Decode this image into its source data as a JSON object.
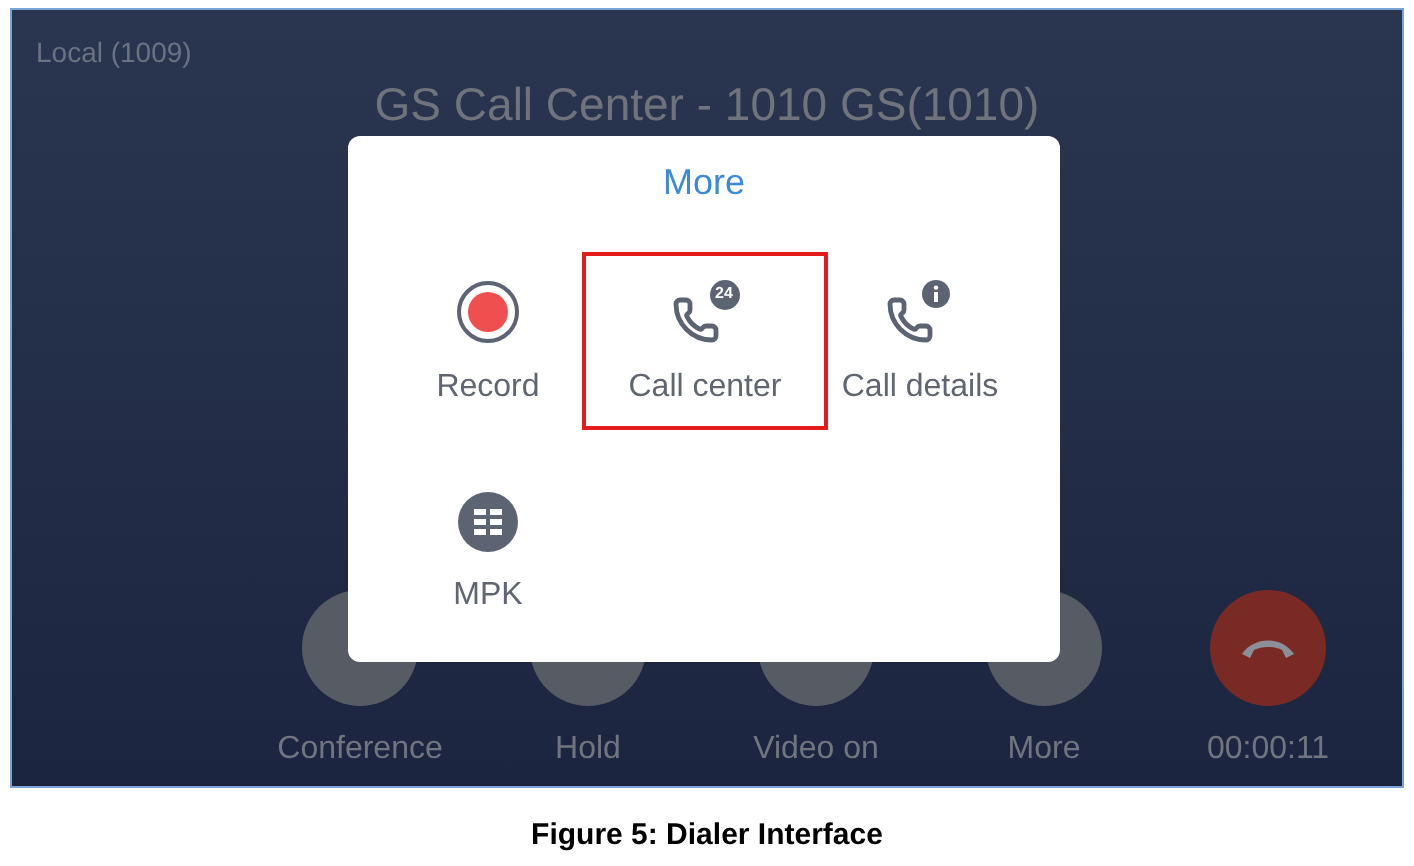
{
  "screen": {
    "account": "Local (1009)",
    "call_title": "GS Call Center - 1010 GS(1010)",
    "controls": [
      {
        "label": "Conference",
        "kind": "round"
      },
      {
        "label": "Hold",
        "kind": "round"
      },
      {
        "label": "Video on",
        "kind": "round"
      },
      {
        "label": "More",
        "kind": "round"
      },
      {
        "label": "00:00:11",
        "kind": "hangup"
      }
    ]
  },
  "dialog": {
    "title": "More",
    "items": [
      {
        "label": "Record",
        "kind": "record",
        "highlighted": false
      },
      {
        "label": "Call center",
        "kind": "callcenter",
        "badge": "24",
        "highlighted": true
      },
      {
        "label": "Call details",
        "kind": "details",
        "highlighted": false
      },
      {
        "label": "MPK",
        "kind": "mpk",
        "highlighted": false
      }
    ]
  },
  "caption": "Figure 5: Dialer Interface"
}
